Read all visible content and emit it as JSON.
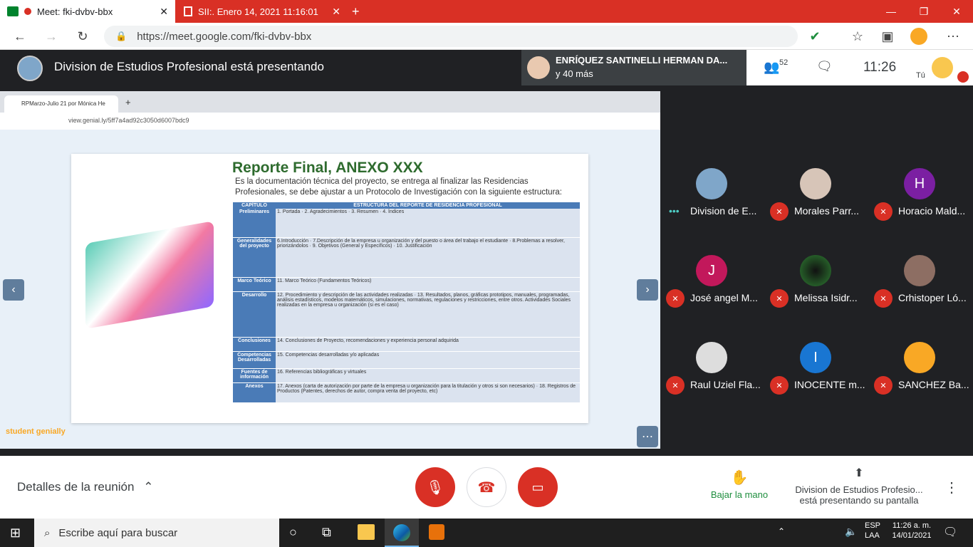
{
  "browser": {
    "tabs": [
      {
        "label": "Meet: fki-dvbv-bbx"
      },
      {
        "label": "SII:. Enero 14, 2021 11:16:01"
      }
    ],
    "url": "https://meet.google.com/fki-dvbv-bbx"
  },
  "meet": {
    "presenting_title": "Division de Estudios Profesional está presentando",
    "speaker_name": "ENRÍQUEZ SANTINELLI HERMAN DA...",
    "speaker_more": "y 40 más",
    "participant_count": "52",
    "time": "11:26",
    "you_label": "Tú"
  },
  "shared_screen": {
    "tab_label": "RPMarzo-Julio 21 por Mónica He",
    "url": "view.genial.ly/5ff7a4ad92c3050d6007bdc9",
    "slide_title": "Reporte Final, ANEXO XXX",
    "slide_subtitle": "Es la documentación técnica del proyecto, se entrega al finalizar las Residencias Profesionales, se debe ajustar a un Protocolo de Investigación con la siguiente estructura:",
    "table_headers": [
      "CAPÍTULO",
      "ESTRUCTURA DEL REPORTE DE RESIDENCIA PROFESIONAL"
    ],
    "table_rows": [
      {
        "cap": "Preliminares",
        "items": "1. Portada · 2. Agradecimientos · 3. Resumen · 4. Índices"
      },
      {
        "cap": "Generalidades del proyecto",
        "items": "6.Introducción · 7.Descripción de la empresa u organización y del puesto o área del trabajo el estudiante · 8.Problemas a resolver, priorizándolos · 9. Objetivos (General y Específicos) · 10. Justificación"
      },
      {
        "cap": "Marco Teórico",
        "items": "11. Marco Teórico (Fundamentos Teóricos)"
      },
      {
        "cap": "Desarrollo",
        "items": "12. Procedimiento y descripción de las actividades realizadas · 13. Resultados, planos, gráficas prototipos, manuales, programadas, análisis estadísticos, modelos matemáticos, simulaciones, normativas, regulaciones y restricciones, entre otros. Actividades Sociales realizadas en la empresa u organización (si es el caso)"
      },
      {
        "cap": "Conclusiones",
        "items": "14. Conclusiones de Proyecto, recomendaciones y experiencia personal adquirida"
      },
      {
        "cap": "Competencias Desarrolladas",
        "items": "15. Competencias desarrolladas y/o aplicadas"
      },
      {
        "cap": "Fuentes de información",
        "items": "16. Referencias bibliográficas y virtuales"
      },
      {
        "cap": "Anexos",
        "items": "17. Anexos (carta de autorización por parte de la empresa u organización para la titulación y otros si son necesarios) · 18. Registros de Productos (Patentes, derechos de autor, compra venta del proyecto, etc)"
      }
    ],
    "brand": "student genially"
  },
  "participants": [
    {
      "name": "Division de E...",
      "initial": "",
      "color": "#5f6368"
    },
    {
      "name": "Morales Parr...",
      "initial": "",
      "color": "#888"
    },
    {
      "name": "Horacio Mald...",
      "initial": "H",
      "color": "#7b1fa2"
    },
    {
      "name": "José angel M...",
      "initial": "J",
      "color": "#c2185b"
    },
    {
      "name": "Melissa Isidr...",
      "initial": "",
      "color": "#2e7d32"
    },
    {
      "name": "Crhistoper Ló...",
      "initial": "",
      "color": "#795548"
    },
    {
      "name": "Raul Uziel Fla...",
      "initial": "",
      "color": "#aaa"
    },
    {
      "name": "INOCENTE m...",
      "initial": "I",
      "color": "#1976d2"
    },
    {
      "name": "SANCHEZ Ba...",
      "initial": "",
      "color": "#f9a825"
    }
  ],
  "bottom": {
    "details_label": "Detalles de la reunión",
    "raise_hand_label": "Bajar la mano",
    "presenting_label": "Division de Estudios Profesio...",
    "presenting_sub": "está presentando su pantalla"
  },
  "taskbar": {
    "search_placeholder": "Escribe aquí para buscar",
    "lang1": "ESP",
    "lang2": "LAA",
    "clock_time": "11:26 a. m.",
    "clock_date": "14/01/2021"
  },
  "colors": {
    "red": "#d93025",
    "meet_dark": "#202124",
    "accent_green": "#1e8e3e"
  }
}
